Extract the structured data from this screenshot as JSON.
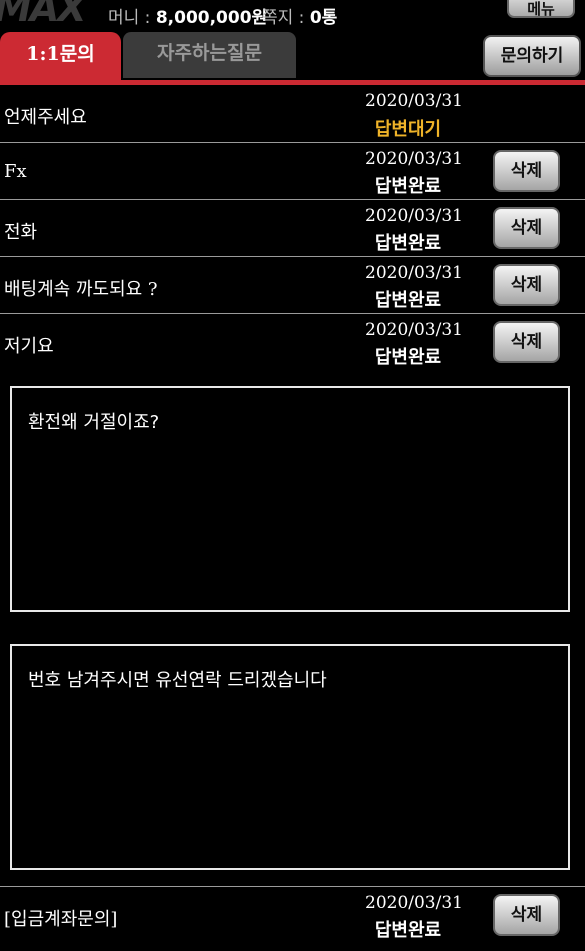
{
  "header": {
    "logo_text": "MAX",
    "money_label": "머니 : ",
    "money_value": "8,000,000원",
    "message_label": "쪽지 : ",
    "message_value": "0통",
    "top_button_label": "메뉴"
  },
  "tabs": {
    "active_label": "1:1문의",
    "inactive_label": "자주하는질문",
    "inquire_button_label": "문의하기"
  },
  "inquiries": [
    {
      "subject": "언제주세요",
      "date": "2020/03/31",
      "status": "답변대기",
      "status_color": "#f0b429"
    },
    {
      "subject": "Fx",
      "date": "2020/03/31",
      "status": "답변완료",
      "status_color": "#ffffff",
      "delete_label": "삭제"
    },
    {
      "subject": "전화",
      "date": "2020/03/31",
      "status": "답변완료",
      "status_color": "#ffffff",
      "delete_label": "삭제"
    },
    {
      "subject": "배팅계속 까도되요 ?",
      "date": "2020/03/31",
      "status": "답변완료",
      "status_color": "#ffffff",
      "delete_label": "삭제"
    },
    {
      "subject": "저기요",
      "date": "2020/03/31",
      "status": "답변완료",
      "status_color": "#ffffff",
      "delete_label": "삭제"
    }
  ],
  "detail": {
    "question_text": "환전왜 거절이죠?",
    "answer_text": "번호 남겨주시면 유선연락 드리겠습니다"
  },
  "last_inquiry": {
    "subject": "[입금계좌문의]",
    "date": "2020/03/31",
    "status": "답변완료",
    "status_color": "#ffffff",
    "delete_label": "삭제"
  },
  "colors": {
    "accent_red": "#cc2a33",
    "pending_yellow": "#f0b429"
  }
}
